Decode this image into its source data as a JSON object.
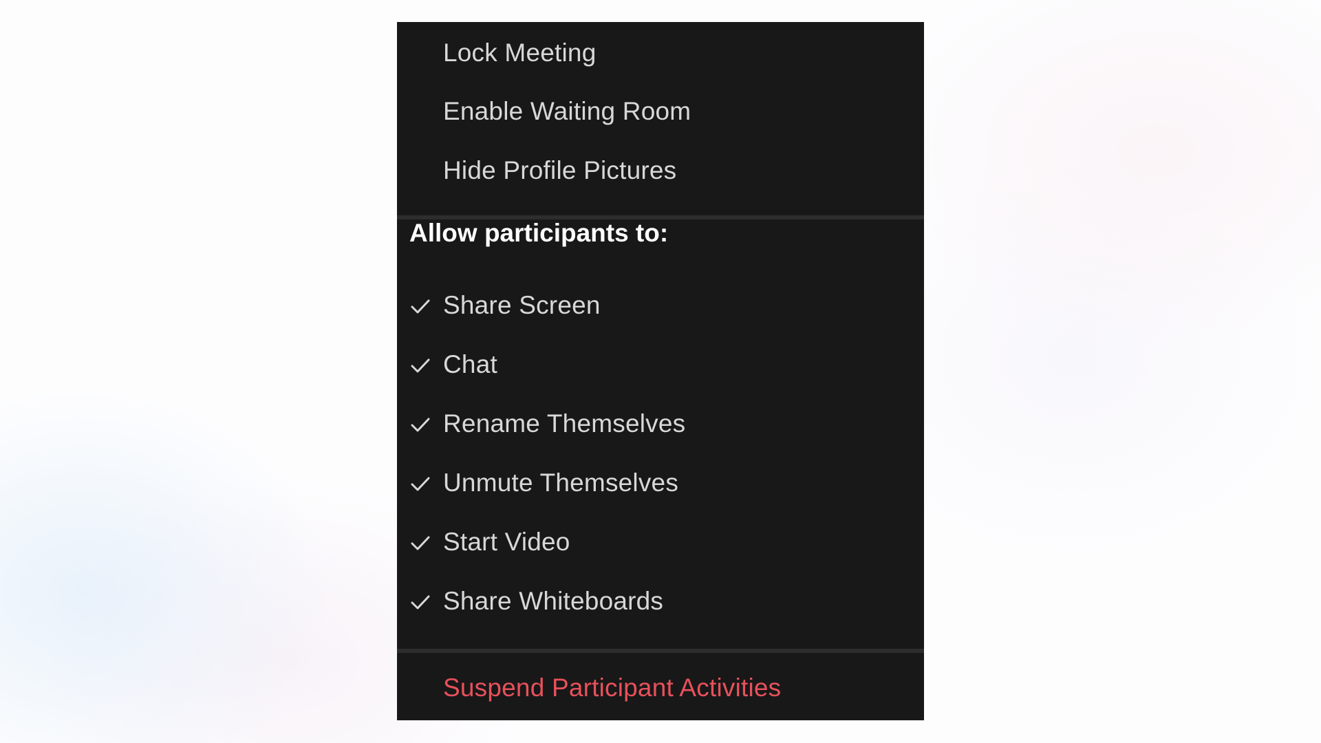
{
  "menu": {
    "top_items": [
      {
        "label": "Lock Meeting",
        "icon": null,
        "checked": false
      },
      {
        "label": "Enable Waiting Room",
        "icon": null,
        "checked": false
      },
      {
        "label": "Hide Profile Pictures",
        "icon": null,
        "checked": false
      }
    ],
    "section_header": "Allow participants to:",
    "permissions": [
      {
        "label": "Share Screen",
        "icon": "checkmark-icon",
        "checked": true
      },
      {
        "label": "Chat",
        "icon": "checkmark-icon",
        "checked": true
      },
      {
        "label": "Rename Themselves",
        "icon": "checkmark-icon",
        "checked": true
      },
      {
        "label": "Unmute Themselves",
        "icon": "checkmark-icon",
        "checked": true
      },
      {
        "label": "Start Video",
        "icon": "checkmark-icon",
        "checked": true
      },
      {
        "label": "Share Whiteboards",
        "icon": "checkmark-icon",
        "checked": true
      }
    ],
    "danger_action": {
      "label": "Suspend Participant Activities"
    }
  },
  "colors": {
    "menu_background": "#181818",
    "divider": "#2d2d2d",
    "item_text": "#d8d8d8",
    "header_text": "#ffffff",
    "danger_text": "#e8515b"
  }
}
